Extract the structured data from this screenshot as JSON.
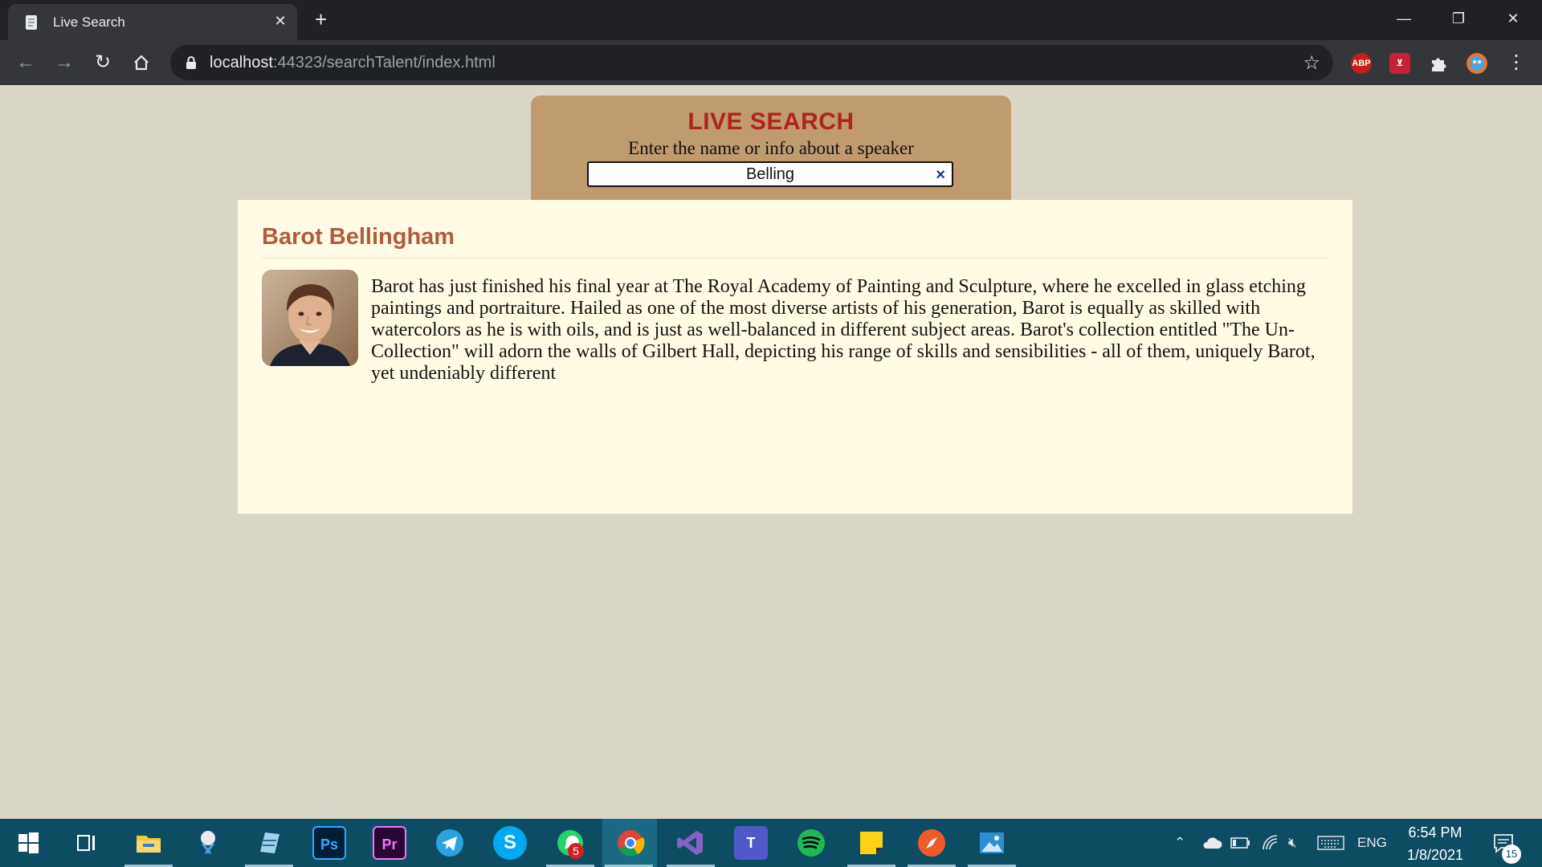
{
  "browser": {
    "tab_title": "Live Search",
    "tab_close": "✕",
    "new_tab": "+",
    "url_host": "localhost",
    "url_rest": ":44323/searchTalent/index.html",
    "window_controls": {
      "minimize": "—",
      "restore": "❐",
      "close": "✕"
    }
  },
  "search": {
    "title": "LIVE SEARCH",
    "subtitle": "Enter the name or info about a speaker",
    "query": "Belling",
    "clear_label": "×"
  },
  "result": {
    "name": "Barot Bellingham",
    "bio": "Barot has just finished his final year at The Royal Academy of Painting and Sculpture, where he excelled in glass etching paintings and portraiture. Hailed as one of the most diverse artists of his generation, Barot is equally as skilled with watercolors as he is with oils, and is just as well-balanced in different subject areas. Barot's collection entitled \"The Un-Collection\" will adorn the walls of Gilbert Hall, depicting his range of skills and sensibilities - all of them, uniquely Barot, yet undeniably different"
  },
  "extensions": {
    "abp": "ABP"
  },
  "taskbar": {
    "photoshop": "Ps",
    "premiere": "Pr",
    "skype": "S",
    "teams": "T",
    "whatsapp_badge": "5",
    "language": "ENG",
    "time": "6:54 PM",
    "date": "1/8/2021",
    "notifications": "15"
  },
  "colors": {
    "page_bg": "#dad7c6",
    "search_panel": "#bf9b6e",
    "title_red": "#b0251b",
    "result_bg": "#fffbe5",
    "name_color": "#b45a3c"
  }
}
